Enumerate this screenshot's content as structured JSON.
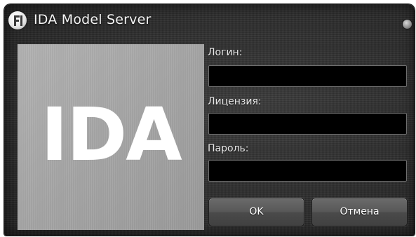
{
  "window": {
    "title": "IDA Model Server",
    "app_icon": "ida-logo-icon",
    "close_control": "close-circle-icon"
  },
  "logo": {
    "text": "IDA"
  },
  "form": {
    "login": {
      "label": "Логин:",
      "value": ""
    },
    "license": {
      "label": "Лицензия:",
      "value": ""
    },
    "password": {
      "label": "Пароль:",
      "value": ""
    }
  },
  "buttons": {
    "ok_label": "OK",
    "cancel_label": "Отмена"
  },
  "colors": {
    "window_background": "#2f2f2f",
    "logo_panel": "#a8a8a8",
    "input_background": "#000000",
    "text": "#ffffff"
  }
}
